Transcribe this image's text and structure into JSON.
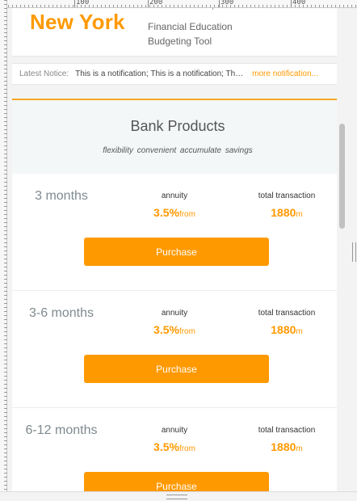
{
  "ruler": {
    "labels": [
      "100",
      "200",
      "300",
      "400"
    ]
  },
  "header": {
    "city": "New York",
    "tool_title_line1": "Financial Education",
    "tool_title_line2": "Budgeting Tool"
  },
  "notice": {
    "label": "Latest Notice:",
    "text": "This is a notification; This is a notification; This is a notification;",
    "more": "more notification..."
  },
  "products": {
    "title": "Bank Products",
    "tags": "flexibility  convenient  accumulate savings",
    "items": [
      {
        "period": "3 months",
        "annuity_label": "annuity",
        "annuity_value": "3.5%",
        "annuity_unit": "from",
        "total_label": "total transaction",
        "total_value": "1880",
        "total_unit": "m",
        "button": "Purchase"
      },
      {
        "period": "3-6 months",
        "annuity_label": "annuity",
        "annuity_value": "3.5%",
        "annuity_unit": "from",
        "total_label": "total transaction",
        "total_value": "1880",
        "total_unit": "m",
        "button": "Purchase"
      },
      {
        "period": "6-12 months",
        "annuity_label": "annuity",
        "annuity_value": "3.5%",
        "annuity_unit": "from",
        "total_label": "total transaction",
        "total_value": "1880",
        "total_unit": "m",
        "button": "Purchase"
      }
    ]
  },
  "colors": {
    "accent": "#ff9900",
    "period_text": "#7f8a8f",
    "head_bg": "#f4f7f8"
  }
}
